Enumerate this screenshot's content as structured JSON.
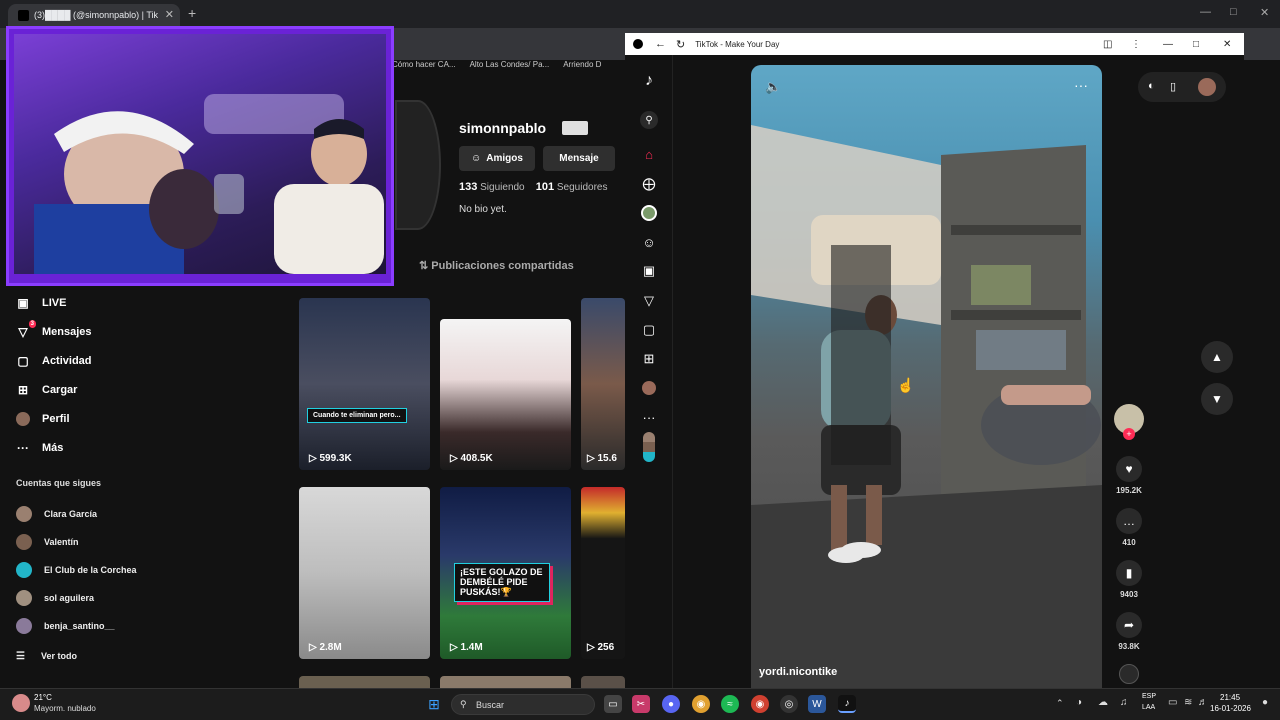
{
  "browser": {
    "tab_title": "(3)████ (@simonnpablo) | Tik",
    "new_tab": "+",
    "close": "✕"
  },
  "bookmarks": [
    "Cómo hacer CA...",
    "Alto Las Condes/ Pa...",
    "Arriendo D"
  ],
  "sidebar": {
    "items": [
      {
        "label": "LIVE",
        "icon": "live-icon",
        "glyph": "▣"
      },
      {
        "label": "Mensajes",
        "icon": "messages-icon",
        "glyph": "▽",
        "badge": "3"
      },
      {
        "label": "Actividad",
        "icon": "activity-icon",
        "glyph": "▢"
      },
      {
        "label": "Cargar",
        "icon": "upload-icon",
        "glyph": "⊞"
      },
      {
        "label": "Perfil",
        "icon": "profile-icon",
        "glyph": "●"
      },
      {
        "label": "Más",
        "icon": "more-icon",
        "glyph": "···"
      }
    ]
  },
  "following": {
    "title": "Cuentas que sigues",
    "accounts": [
      "Clara García",
      "Valentín",
      "El Club de la Corchea",
      "sol aguilera",
      "benja_santino__"
    ],
    "see_all": "Ver todo"
  },
  "profile": {
    "username": "simonnpablo",
    "friends_btn": "Amigos",
    "message_btn": "Mensaje",
    "following_count": "133",
    "following_label": "Siguiendo",
    "followers_count": "101",
    "followers_label": "Seguidores",
    "bio": "No bio yet.",
    "shared_tab": "Publicaciones compartidas"
  },
  "videos": [
    {
      "views": "599.3K",
      "caption": "Cuando te eliminan pero..."
    },
    {
      "views": "408.5K"
    },
    {
      "views": "15.6"
    },
    {
      "views": "2.8M"
    },
    {
      "views": "1.4M",
      "caption": "¡ESTE GOLAZO DE DEMBÉLÉ PIDE PUSKÁS!🏆"
    },
    {
      "views": "256"
    }
  ],
  "popup": {
    "title": "TikTok - Make Your Day",
    "video_user": "yordi.nicontike",
    "likes": "195.2K",
    "comments": "410",
    "saves": "9403",
    "shares": "93.8K"
  },
  "taskbar": {
    "temp": "21°C",
    "weather": "Mayorm. nublado",
    "search": "Buscar",
    "lang1": "ESP",
    "lang2": "LAA",
    "time": "21:45",
    "date": "16-01-2026"
  }
}
